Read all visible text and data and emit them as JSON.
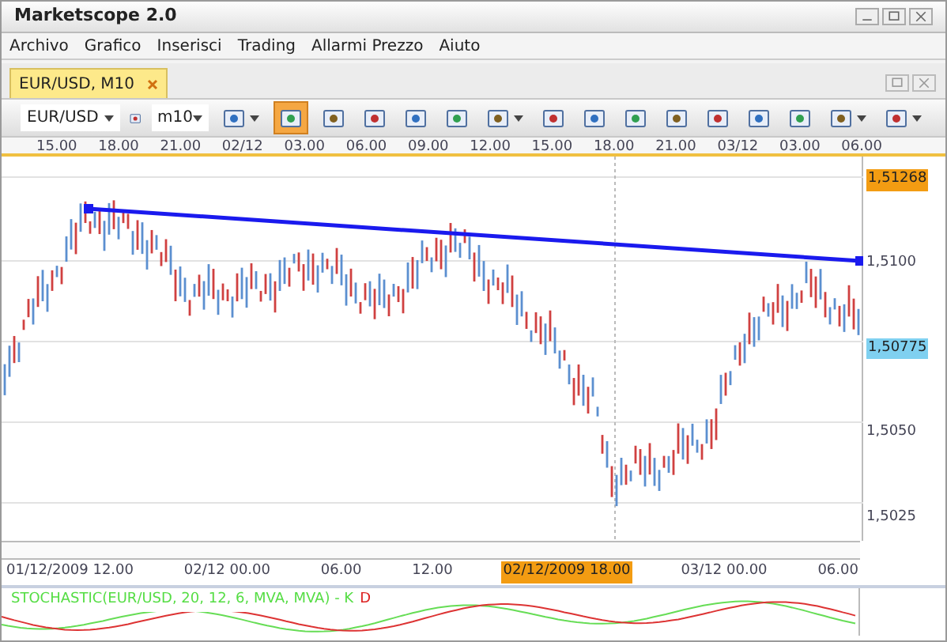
{
  "window": {
    "title": "Marketscope 2.0"
  },
  "menu": [
    "Archivo",
    "Grafico",
    "Inserisci",
    "Trading",
    "Allarmi Prezzo",
    "Aiuto"
  ],
  "tabs": [
    {
      "label": "EUR/USD, M10",
      "selected": true
    }
  ],
  "toolbar": {
    "symbol": "EUR/USD",
    "timeframe": "m10",
    "buttons": [
      {
        "kind": "dropdown",
        "selected": false
      },
      {
        "kind": "button",
        "selected": true
      },
      {
        "kind": "button",
        "selected": false
      },
      {
        "kind": "button",
        "selected": false
      },
      {
        "kind": "button",
        "selected": false
      },
      {
        "kind": "button",
        "selected": false
      },
      {
        "kind": "dropdown",
        "selected": false
      },
      {
        "kind": "button",
        "selected": false
      },
      {
        "kind": "button",
        "selected": false
      },
      {
        "kind": "button",
        "selected": false
      },
      {
        "kind": "button",
        "selected": false
      },
      {
        "kind": "button",
        "selected": false
      },
      {
        "kind": "button",
        "selected": false
      },
      {
        "kind": "button",
        "selected": false
      },
      {
        "kind": "dropdown",
        "selected": false
      },
      {
        "kind": "dropdown",
        "selected": false
      }
    ]
  },
  "top_axis": [
    "15.00",
    "18.00",
    "21.00",
    "02/12",
    "03.00",
    "06.00",
    "09.00",
    "12.00",
    "15.00",
    "18.00",
    "21.00",
    "03/12",
    "03.00",
    "06.00"
  ],
  "price_axis": [
    {
      "label": "1,51268",
      "kind": "badge",
      "color": "#f39c12"
    },
    {
      "label": "1,5100",
      "kind": "tick"
    },
    {
      "label": "1,50775",
      "kind": "badge",
      "color": "#7fd0f0"
    },
    {
      "label": "1,5050",
      "kind": "tick"
    },
    {
      "label": "1,5025",
      "kind": "tick"
    }
  ],
  "bottom_axis": [
    {
      "label": "01/12/2009 12.00",
      "selected": false
    },
    {
      "label": "02/12 00.00",
      "selected": false
    },
    {
      "label": "06.00",
      "selected": false
    },
    {
      "label": "12.00",
      "selected": false
    },
    {
      "label": "02/12/2009 18.00",
      "selected": true
    },
    {
      "label": "03/12 00.00",
      "selected": false
    },
    {
      "label": "06.00",
      "selected": false
    }
  ],
  "indicator": {
    "legend": [
      {
        "text": "STOCHASTIC(EUR/USD, 20, 12, 6, MVA, MVA) - K",
        "color": "#55dd44"
      },
      {
        "text": "D",
        "color": "#dd2222"
      }
    ]
  }
}
